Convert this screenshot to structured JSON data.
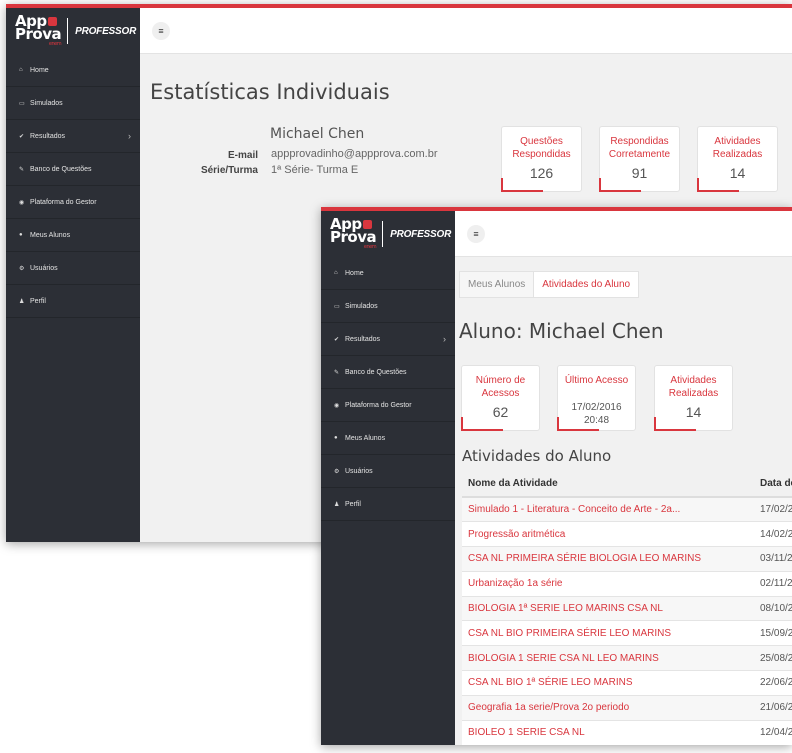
{
  "brand": {
    "logo_line1": "App",
    "logo_line2": "Prova",
    "logo_sub": "enem",
    "role": "PROFESSOR"
  },
  "colors": {
    "accent": "#d9363e",
    "sidebar": "#2c2f36",
    "content_bg": "#f1f1f1"
  },
  "sidebar": {
    "items": [
      {
        "label": "Home",
        "icon": "home-icon"
      },
      {
        "label": "Simulados",
        "icon": "laptop-icon"
      },
      {
        "label": "Resultados",
        "icon": "check-icon"
      },
      {
        "label": "Banco de Questões",
        "icon": "edit-icon"
      },
      {
        "label": "Plataforma do Gestor",
        "icon": "dashboard-icon"
      },
      {
        "label": "Meus Alunos",
        "icon": "users-icon"
      },
      {
        "label": "Usuários",
        "icon": "gear-icon"
      },
      {
        "label": "Perfil",
        "icon": "user-icon"
      }
    ]
  },
  "topbar": {
    "menu_icon": "hamburger-icon"
  },
  "stats": {
    "title": "Estatísticas Individuais",
    "name": "Michael Chen",
    "email_label": "E-mail",
    "email": "appprovadinho@appprova.com.br",
    "class_label": "Série/Turma",
    "class": "1ª Série- Turma E",
    "cards": [
      {
        "title": "Questões Respondidas",
        "value": "126"
      },
      {
        "title": "Respondidas Corretamente",
        "value": "91"
      },
      {
        "title": "Atividades Realizadas",
        "value": "14"
      }
    ]
  },
  "student": {
    "breadcrumb": [
      "Meus Alunos",
      "Atividades do Aluno"
    ],
    "title": "Aluno: Michael Chen",
    "cards": [
      {
        "title": "Número de Acessos",
        "value": "62"
      },
      {
        "title": "Último Acesso",
        "value": "17/02/2016",
        "value2": "20:48"
      },
      {
        "title": "Atividades Realizadas",
        "value": "14"
      }
    ],
    "activities_title": "Atividades do Aluno",
    "columns": [
      "Nome da Atividade",
      "Data de"
    ],
    "rows": [
      {
        "name": "Simulado 1 - Literatura - Conceito de Arte - 2a...",
        "date": "17/02/2"
      },
      {
        "name": "Progressão aritmética",
        "date": "14/02/2"
      },
      {
        "name": "CSA NL PRIMEIRA SÉRIE BIOLOGIA LEO MARINS",
        "date": "03/11/2"
      },
      {
        "name": "Urbanização 1a série",
        "date": "02/11/2"
      },
      {
        "name": "BIOLOGIA 1ª SERIE LEO MARINS CSA NL",
        "date": "08/10/2"
      },
      {
        "name": "CSA NL BIO PRIMEIRA SÉRIE LEO MARINS",
        "date": "15/09/2"
      },
      {
        "name": "BIOLOGIA 1 SERIE CSA NL LEO MARINS",
        "date": "25/08/2"
      },
      {
        "name": "CSA NL BIO 1ª SÉRIE LEO MARINS",
        "date": "22/06/2"
      },
      {
        "name": "Geografia 1a serie/Prova 2o periodo",
        "date": "21/06/2"
      },
      {
        "name": "BIOLEO 1 SERIE CSA NL",
        "date": "12/04/2"
      }
    ]
  }
}
